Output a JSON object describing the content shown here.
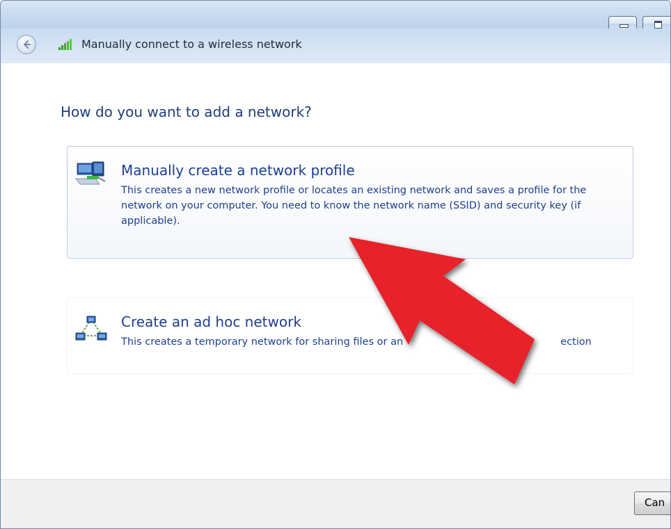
{
  "window": {
    "title": "Manually connect to a wireless network",
    "minimize_icon": "minimize-icon",
    "maximize_icon": "maximize-icon"
  },
  "navbar": {
    "back_icon": "back-arrow-icon",
    "network_icon": "wireless-signal-icon",
    "title": "Manually connect to a wireless network"
  },
  "main": {
    "heading": "How do you want to add a network?",
    "options": [
      {
        "icon": "network-profile-icon",
        "title": "Manually create a network profile",
        "description": "This creates a new network profile or locates an existing network and saves a profile for the network on your computer. You need to know the network name (SSID) and security key (if applicable)."
      },
      {
        "icon": "ad-hoc-network-icon",
        "title": "Create an ad hoc network",
        "description": "This creates a temporary network for sharing files or an",
        "description_tail": "ection"
      }
    ]
  },
  "footer": {
    "cancel_label": "Can"
  },
  "annotation": {
    "arrow_color": "#e8232a",
    "arrow_icon": "red-arrow-annotation"
  }
}
